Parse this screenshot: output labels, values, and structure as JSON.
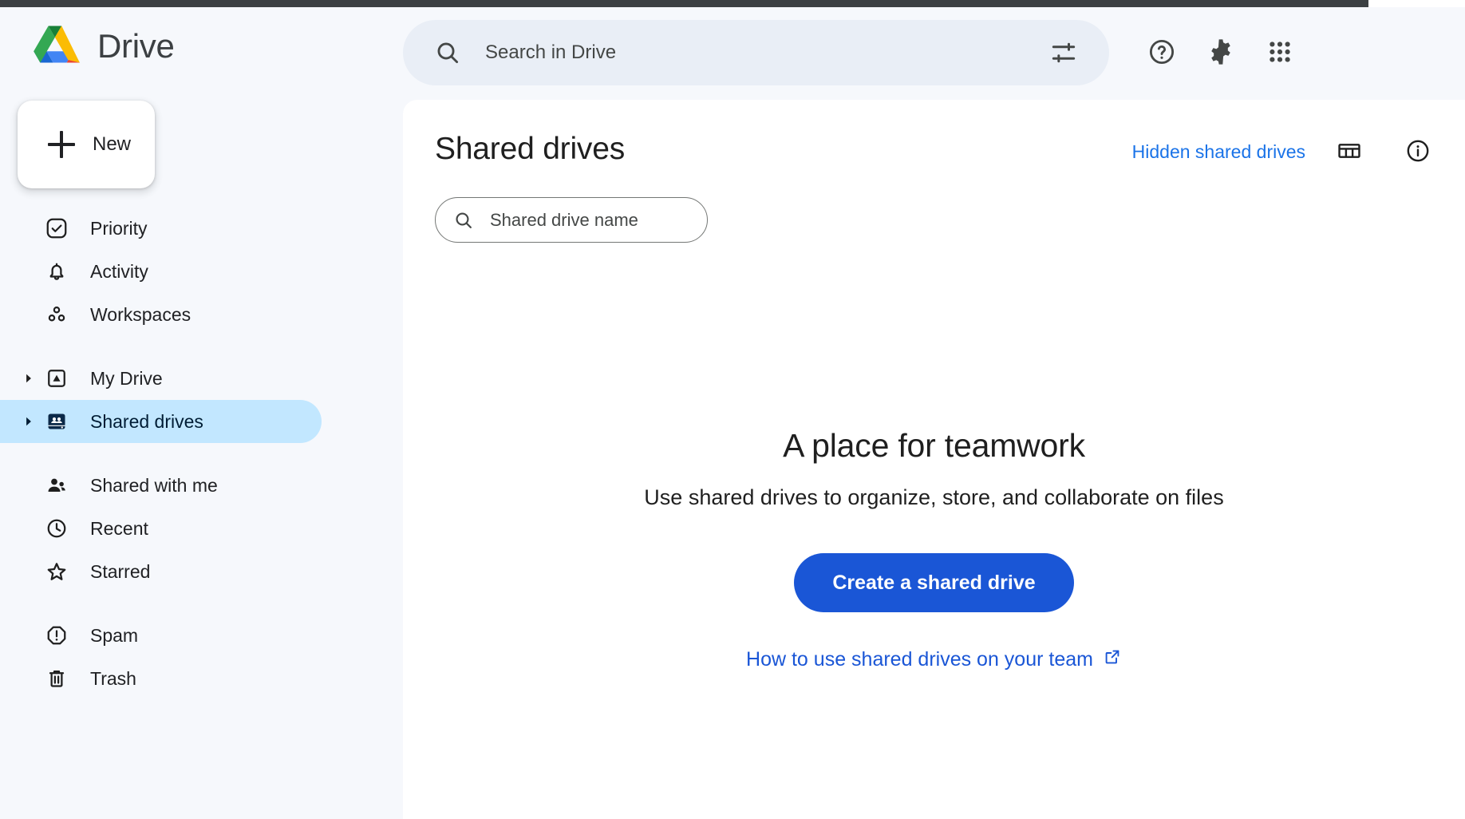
{
  "app": {
    "brand_name": "Drive",
    "logo_icon": "google-drive-logo"
  },
  "sidebar": {
    "new_button": {
      "label": "New",
      "icon": "plus-icon"
    },
    "groups": [
      {
        "items": [
          {
            "label": "Priority",
            "icon": "check-circle-icon",
            "active": false,
            "caret": false
          },
          {
            "label": "Activity",
            "icon": "bell-icon",
            "active": false,
            "caret": false
          },
          {
            "label": "Workspaces",
            "icon": "workspaces-icon",
            "active": false,
            "caret": false
          }
        ]
      },
      {
        "items": [
          {
            "label": "My Drive",
            "icon": "my-drive-icon",
            "active": false,
            "caret": true
          },
          {
            "label": "Shared drives",
            "icon": "shared-drives-icon",
            "active": true,
            "caret": true
          }
        ]
      },
      {
        "items": [
          {
            "label": "Shared with me",
            "icon": "people-icon",
            "active": false,
            "caret": false
          },
          {
            "label": "Recent",
            "icon": "clock-icon",
            "active": false,
            "caret": false
          },
          {
            "label": "Starred",
            "icon": "star-icon",
            "active": false,
            "caret": false
          }
        ]
      },
      {
        "items": [
          {
            "label": "Spam",
            "icon": "spam-octagon-icon",
            "active": false,
            "caret": false
          },
          {
            "label": "Trash",
            "icon": "trash-icon",
            "active": false,
            "caret": false
          }
        ]
      }
    ]
  },
  "search": {
    "placeholder": "Search in Drive",
    "value": "",
    "search_icon": "search-icon",
    "filter_icon": "tune-icon"
  },
  "header_actions": [
    {
      "icon": "help-circle-icon",
      "name": "help-button"
    },
    {
      "icon": "gear-icon",
      "name": "settings-button"
    },
    {
      "icon": "apps-grid-icon",
      "name": "google-apps-button"
    }
  ],
  "main": {
    "title": "Shared drives",
    "hidden_drives_link": "Hidden shared drives",
    "grid_view_icon": "grid-view-icon",
    "info_icon": "info-circle-icon",
    "drive_filter": {
      "placeholder": "Shared drive name",
      "value": "",
      "icon": "search-icon"
    },
    "empty_state": {
      "title": "A place for teamwork",
      "subtitle": "Use shared drives to organize, store, and collaborate on files",
      "cta_label": "Create a shared drive",
      "help_link_label": "How to use shared drives on your team",
      "help_link_icon": "external-link-icon"
    }
  },
  "colors": {
    "accent_blue": "#1a73e8",
    "cta_blue": "#1a56d6",
    "active_pill": "#c2e7ff",
    "active_text": "#001d35",
    "page_bg": "#f6f8fc",
    "search_bg": "#e9eef6"
  }
}
